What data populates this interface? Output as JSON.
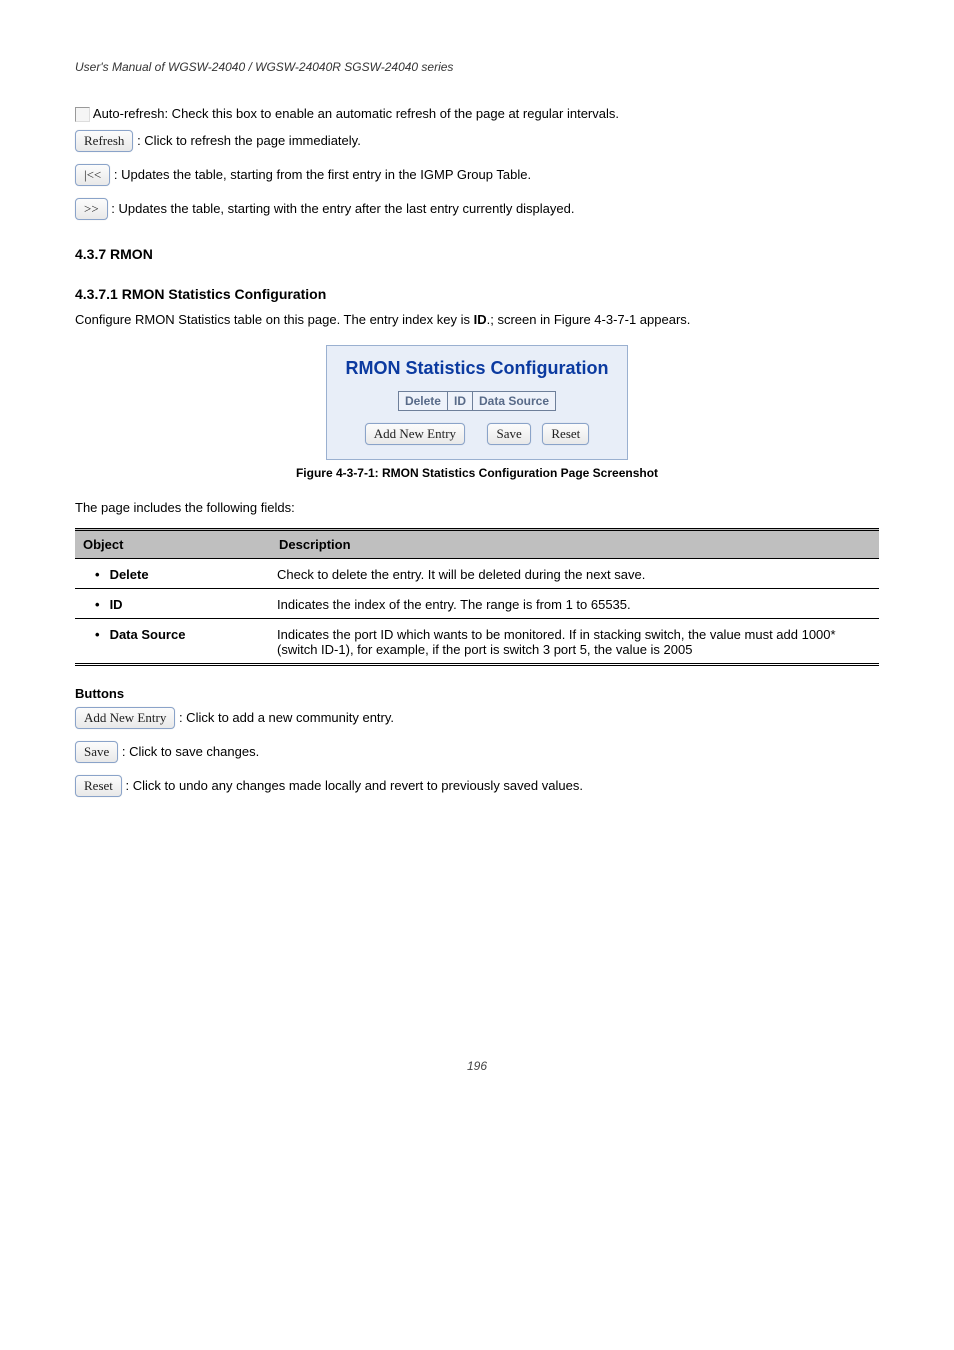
{
  "header": "User's Manual of WGSW-24040 / WGSW-24040R  SGSW-24040 series",
  "autoRefresh": {
    "label": "Auto-refresh",
    "desc": ": Check this box to enable an automatic refresh of the page at regular intervals."
  },
  "topButtons": {
    "refresh": {
      "label": "Refresh",
      "desc": ": Click to refresh the page immediately."
    },
    "first": {
      "label": "|<<",
      "desc": ": Updates the table, starting from the first entry in the IGMP Group Table."
    },
    "next": {
      "label": ">>",
      "desc": ": Updates the table, starting with the entry after the last entry currently displayed."
    }
  },
  "sectionNumber": "4.3.7 RMON",
  "subsectionTitle": "4.3.7.1 RMON Statistics Configuration",
  "subsectionIntro1": "Configure RMON Statistics table on this page. The entry index key is ",
  "subsectionIntroBold": "ID",
  "subsectionIntro2": ".; screen in Figure 4-3-7-1 appears.",
  "panel": {
    "title": "RMON Statistics Configuration",
    "headers": [
      "Delete",
      "ID",
      "Data Source"
    ],
    "buttons": {
      "add": "Add New Entry",
      "save": "Save",
      "reset": "Reset"
    }
  },
  "figureLabel": "Figure 4-3-7-1: RMON Statistics Configuration Page Screenshot",
  "tableIntro": "The page includes the following fields:",
  "objTable": {
    "head": [
      "Object",
      "Description"
    ],
    "rows": [
      {
        "obj": "Delete",
        "desc": "Check to delete the entry. It will be deleted during the next save."
      },
      {
        "obj": "ID",
        "desc": "Indicates the index of the entry. The range is from 1 to 65535."
      },
      {
        "obj": "Data Source",
        "desc": "Indicates the port ID which wants to be monitored. If in stacking switch, the value must add 1000*(switch ID-1), for example, if the port is switch 3 port 5, the value is 2005"
      }
    ]
  },
  "buttonsHeading": "Buttons",
  "bottomButtons": {
    "add": {
      "label": "Add New Entry",
      "desc": ": Click to add a new community entry."
    },
    "save": {
      "label": "Save",
      "desc": ": Click to save changes."
    },
    "reset": {
      "label": "Reset",
      "desc": ": Click to undo any changes made locally and revert to previously saved values."
    }
  },
  "footer": "196"
}
